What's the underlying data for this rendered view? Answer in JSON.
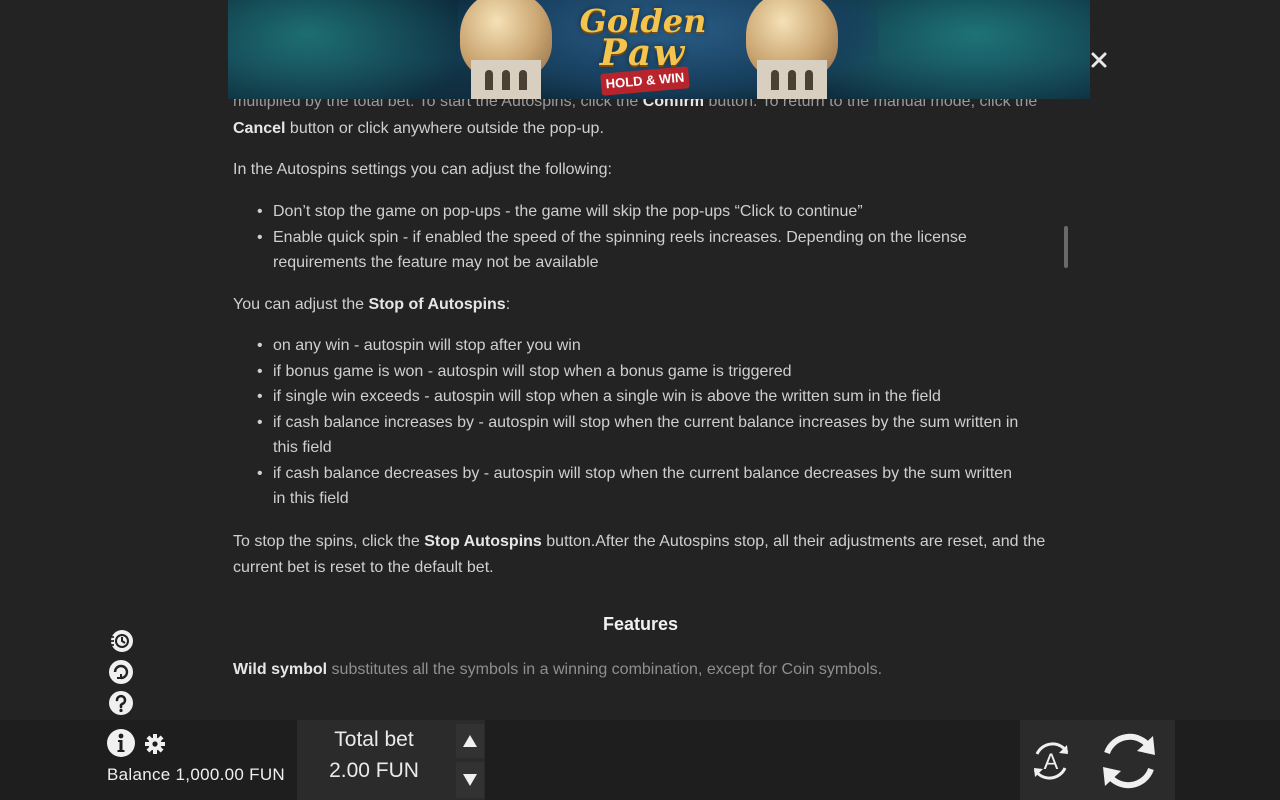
{
  "banner": {
    "logo_line1": "Golden",
    "logo_line2": "Paw",
    "logo_ribbon": "HOLD & WIN"
  },
  "content": {
    "cut_line_a": "multiplied by the total bet. To start the Autospins, click the ",
    "cut_line_confirm": "Confirm",
    "cut_line_b": " button. To return to the manual mode, click the",
    "cancel_word": "Cancel",
    "cancel_rest": " button or click anywhere outside the pop-up.",
    "settings_intro": "In the Autospins settings you can adjust the following:",
    "settings_bullets": [
      "Don’t stop the game on pop-ups - the game will skip the pop-ups “Click to continue”",
      "Enable quick spin - if enabled the speed of the spinning reels increases. Depending on the license requirements the feature may not be available"
    ],
    "stop_intro_a": "You can adjust the ",
    "stop_intro_bold": "Stop of Autospins",
    "stop_intro_b": ":",
    "stop_bullets": [
      "on any win - autospin will stop after you win",
      "if bonus game is won - autospin will stop when a bonus game is triggered",
      "if single win exceeds - autospin will stop when a single win is above the written sum in the field",
      "if cash balance increases by - autospin will stop when the current balance increases by the sum written in this field",
      "if cash balance decreases by - autospin will stop when the current balance decreases by the sum written in this field"
    ],
    "stop_para_a": "To stop the spins, click the ",
    "stop_para_bold": "Stop Autospins",
    "stop_para_b": " button.After the Autospins stop, all their adjustments are reset, and the current bet is reset to the default bet.",
    "features_title": "Features",
    "wild_bold": "Wild symbol",
    "wild_rest": " substitutes all the symbols in a winning combination, except for Coin symbols."
  },
  "bottom": {
    "balance": "Balance 1,000.00 FUN",
    "total_bet_label": "Total bet",
    "total_bet_value": "2.00 FUN",
    "autospin_letter": "A"
  },
  "icons": {
    "close": "close-icon",
    "turbo": "turbo-icon",
    "autoplay": "autoplay-icon",
    "help": "help-icon",
    "info": "info-icon",
    "settings": "gear-icon",
    "bet_up": "triangle-up-icon",
    "bet_down": "triangle-down-icon",
    "autospin": "autospin-icon",
    "spin": "spin-icon"
  }
}
